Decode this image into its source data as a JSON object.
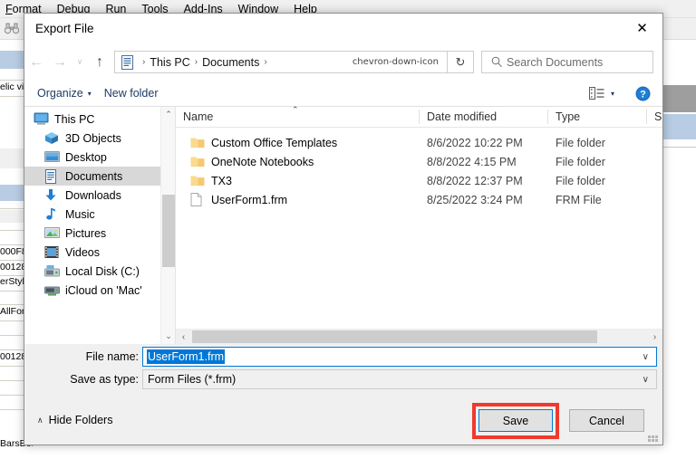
{
  "background_app": {
    "menus": [
      "Format",
      "Debug",
      "Run",
      "Tools",
      "Add-Ins",
      "Window",
      "Help"
    ],
    "toolbar_icon": "binoculars-icon",
    "property_fragments": [
      "elic vi",
      "000F8",
      "00128",
      "erStyle",
      "AllForm",
      "00128",
      "BarsBoth"
    ]
  },
  "dialog": {
    "title": "Export File",
    "close_label": "✕",
    "nav": {
      "back": "←",
      "forward": "→",
      "recent": "∨",
      "up": "↑",
      "breadcrumb_icon": "documents-folder-icon",
      "breadcrumb": [
        "This PC",
        "Documents"
      ],
      "breadcrumb_sep": "›",
      "dropdown_icon": "chevron-down-icon",
      "refresh_icon": "↻",
      "search_icon": "search-icon",
      "search_placeholder": "Search Documents",
      "search_value": ""
    },
    "commandbar": {
      "organize": "Organize",
      "organize_caret": "▾",
      "new_folder": "New folder",
      "view_icon": "view-options-icon",
      "view_caret": "▾",
      "help_icon": "help-icon",
      "help_glyph": "?"
    },
    "nav_pane": {
      "items": [
        {
          "label": "This PC",
          "icon": "this-pc-icon",
          "selected": false,
          "root": true
        },
        {
          "label": "3D Objects",
          "icon": "3d-objects-icon",
          "selected": false,
          "root": false
        },
        {
          "label": "Desktop",
          "icon": "desktop-icon",
          "selected": false,
          "root": false
        },
        {
          "label": "Documents",
          "icon": "documents-icon",
          "selected": true,
          "root": false
        },
        {
          "label": "Downloads",
          "icon": "downloads-icon",
          "selected": false,
          "root": false
        },
        {
          "label": "Music",
          "icon": "music-icon",
          "selected": false,
          "root": false
        },
        {
          "label": "Pictures",
          "icon": "pictures-icon",
          "selected": false,
          "root": false
        },
        {
          "label": "Videos",
          "icon": "videos-icon",
          "selected": false,
          "root": false
        },
        {
          "label": "Local Disk (C:)",
          "icon": "local-disk-icon",
          "selected": false,
          "root": false
        },
        {
          "label": "iCloud on 'Mac'",
          "icon": "network-drive-icon",
          "selected": false,
          "root": false
        }
      ],
      "scroll_up": "⌃",
      "scroll_down": "⌄"
    },
    "file_list": {
      "columns": [
        "Name",
        "Date modified",
        "Type",
        "S"
      ],
      "sort_column": "Name",
      "sort_indicator": "⌃",
      "rows": [
        {
          "name": "Custom Office Templates",
          "date": "8/6/2022 10:22 PM",
          "type": "File folder",
          "icon": "folder-icon"
        },
        {
          "name": "OneNote Notebooks",
          "date": "8/8/2022 4:15 PM",
          "type": "File folder",
          "icon": "folder-icon"
        },
        {
          "name": "TX3",
          "date": "8/8/2022 12:37 PM",
          "type": "File folder",
          "icon": "folder-icon"
        },
        {
          "name": "UserForm1.frm",
          "date": "8/25/2022 3:24 PM",
          "type": "FRM File",
          "icon": "file-icon"
        }
      ],
      "hscroll_left": "‹",
      "hscroll_right": "›"
    },
    "form": {
      "file_name_label": "File name:",
      "file_name_value": "UserForm1.frm",
      "save_as_type_label": "Save as type:",
      "save_as_type_value": "Form Files (*.frm)",
      "chevron": "∨"
    },
    "footer": {
      "hide_folders": "Hide Folders",
      "hide_folders_caret": "∧",
      "save_label": "Save",
      "cancel_label": "Cancel"
    },
    "colors": {
      "annotation": "#ef3a2d",
      "focus": "#0078d7",
      "selection": "#0078d7",
      "selected_row": "#d8d8d8"
    }
  }
}
